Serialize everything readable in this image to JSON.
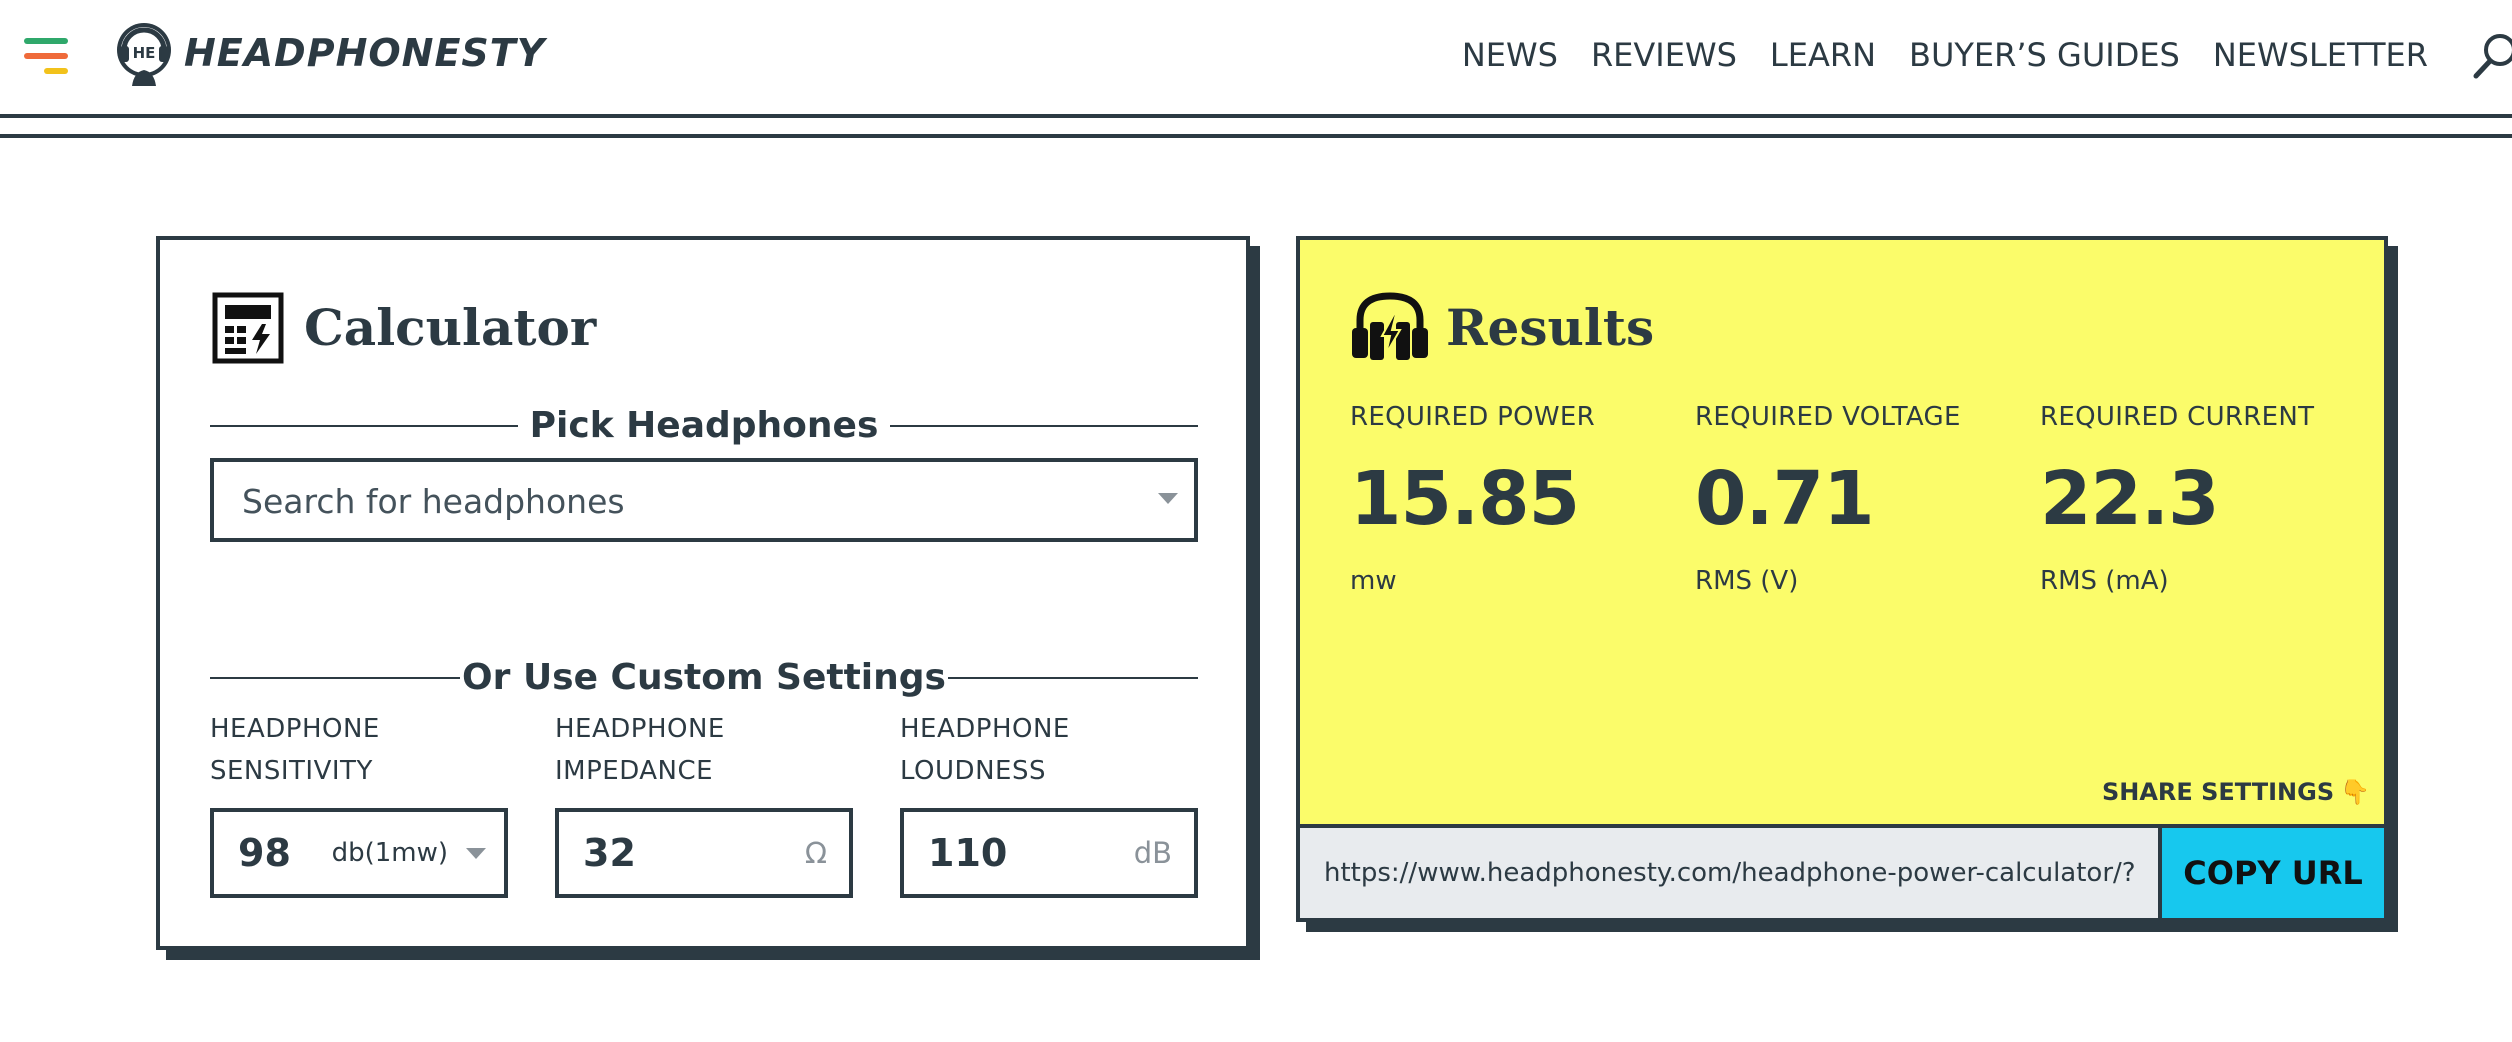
{
  "header": {
    "logo_text": "HEADPHONESTY",
    "logo_monogram": "HE",
    "nav": [
      "NEWS",
      "REVIEWS",
      "LEARN",
      "BUYER’S GUIDES",
      "NEWSLETTER"
    ]
  },
  "calculator": {
    "title": "Calculator",
    "pick_heading": "Pick Headphones",
    "search_placeholder": "Search for headphones",
    "custom_heading": "Or Use Custom Settings",
    "fields": [
      {
        "label": "HEADPHONE SENSITIVITY",
        "value": "98",
        "unit": "db(1mw)"
      },
      {
        "label": "HEADPHONE IMPEDANCE",
        "value": "32",
        "unit": "Ω"
      },
      {
        "label": "HEADPHONE LOUDNESS",
        "value": "110",
        "unit": "dB"
      }
    ]
  },
  "results": {
    "title": "Results",
    "metrics": [
      {
        "label": "REQUIRED POWER",
        "value": "15.85",
        "unit": "mw"
      },
      {
        "label": "REQUIRED VOLTAGE",
        "value": "0.71",
        "unit": "RMS (V)"
      },
      {
        "label": "REQUIRED CURRENT",
        "value": "22.3",
        "unit": "RMS (mA)"
      }
    ],
    "share_label": "SHARE SETTINGS",
    "share_icon": "👇",
    "url": "https://www.headphonesty.com/headphone-power-calculator/?",
    "copy_label": "COPY URL"
  },
  "colors": {
    "ink": "#2c3a43",
    "results_bg": "#fbfc6a",
    "copy_button": "#17c8ee",
    "menu_green": "#2fa86b",
    "menu_orange": "#ef6a3a",
    "menu_yellow": "#f2c21b"
  },
  "icons": [
    "menu-icon",
    "logo-icon",
    "search-icon",
    "calculator-icon",
    "headphones-power-icon",
    "chevron-down-icon",
    "pointing-down-icon"
  ]
}
